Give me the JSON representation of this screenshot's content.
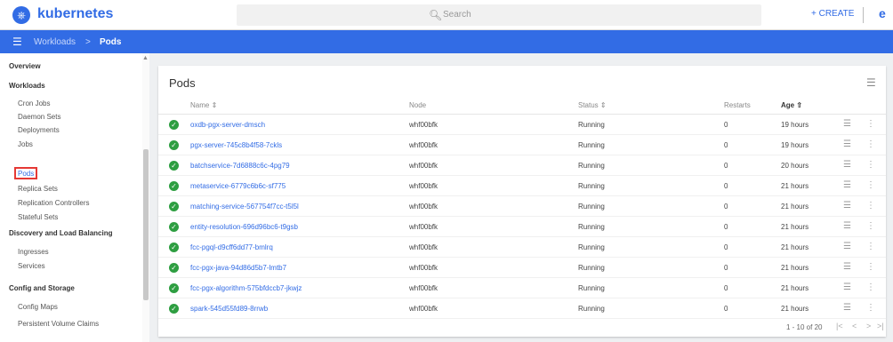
{
  "header": {
    "logo_glyph": "⎈",
    "brand": "kubernetes",
    "search_placeholder": "Search",
    "create_label": "+ CREATE",
    "account_glyph": "e"
  },
  "breadcrumb": {
    "parent": "Workloads",
    "separator": ">",
    "current": "Pods"
  },
  "sidebar": {
    "overview": "Overview",
    "workloads": "Workloads",
    "workload_items": [
      "Cron Jobs",
      "Daemon Sets",
      "Deployments",
      "Jobs",
      "Pods",
      "Replica Sets",
      "Replication Controllers",
      "Stateful Sets"
    ],
    "discovery": "Discovery and Load Balancing",
    "discovery_items": [
      "Ingresses",
      "Services"
    ],
    "config": "Config and Storage",
    "config_items": [
      "Config Maps",
      "Persistent Volume Claims"
    ],
    "active_item": "Pods"
  },
  "pods": {
    "title": "Pods",
    "columns": {
      "name": "Name ⇕",
      "node": "Node",
      "status": "Status ⇕",
      "restarts": "Restarts",
      "age": "Age ⇧"
    },
    "rows": [
      {
        "name": "oxdb-pgx-server-dmsch",
        "node": "whf00bfk",
        "status": "Running",
        "restarts": "0",
        "age": "19 hours"
      },
      {
        "name": "pgx-server-745c8b4f58-7ckls",
        "node": "whf00bfk",
        "status": "Running",
        "restarts": "0",
        "age": "19 hours"
      },
      {
        "name": "batchservice-7d6888c6c-4pg79",
        "node": "whf00bfk",
        "status": "Running",
        "restarts": "0",
        "age": "20 hours"
      },
      {
        "name": "metaservice-6779c6b6c-sf775",
        "node": "whf00bfk",
        "status": "Running",
        "restarts": "0",
        "age": "21 hours"
      },
      {
        "name": "matching-service-567754f7cc-t5l5l",
        "node": "whf00bfk",
        "status": "Running",
        "restarts": "0",
        "age": "21 hours"
      },
      {
        "name": "entity-resolution-696d96bc6-t9gsb",
        "node": "whf00bfk",
        "status": "Running",
        "restarts": "0",
        "age": "21 hours"
      },
      {
        "name": "fcc-pgql-d9cff6dd77-bmlrq",
        "node": "whf00bfk",
        "status": "Running",
        "restarts": "0",
        "age": "21 hours"
      },
      {
        "name": "fcc-pgx-java-94d86d5b7-lmtb7",
        "node": "whf00bfk",
        "status": "Running",
        "restarts": "0",
        "age": "21 hours"
      },
      {
        "name": "fcc-pgx-algorithm-575bfdccb7-jkwjz",
        "node": "whf00bfk",
        "status": "Running",
        "restarts": "0",
        "age": "21 hours"
      },
      {
        "name": "spark-545d55fd89-8rrwb",
        "node": "whf00bfk",
        "status": "Running",
        "restarts": "0",
        "age": "21 hours"
      }
    ],
    "pagination": "1 - 10 of 20"
  },
  "colors": {
    "primary": "#326ce5",
    "running": "#2e9e41",
    "highlight": "#e53935"
  },
  "icons": {
    "search": "search-icon",
    "menu": "menu-icon",
    "filter": "filter-icon",
    "ok": "check-circle-icon",
    "logs": "logs-icon",
    "more": "more-vert-icon"
  }
}
